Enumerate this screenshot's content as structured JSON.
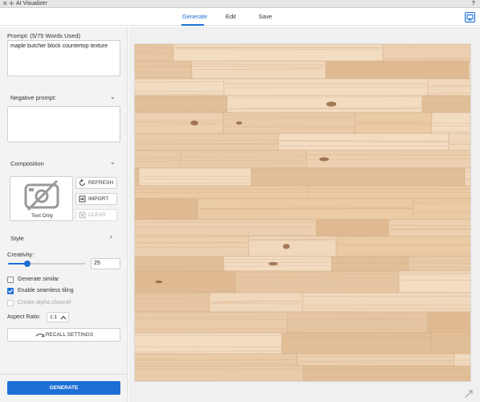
{
  "window": {
    "title": "AI Visualizer",
    "help": "?"
  },
  "tabs": [
    {
      "label": "Generate",
      "active": true
    },
    {
      "label": "Edit",
      "active": false
    },
    {
      "label": "Save",
      "active": false
    }
  ],
  "prompt": {
    "label": "Prompt: (5/75 Words Used)",
    "value": "maple butcher block countertop texture"
  },
  "negative_prompt": {
    "label": "Negative prompt:",
    "value": ""
  },
  "composition": {
    "label": "Composition",
    "thumbnail_caption": "Text Only",
    "buttons": {
      "refresh": "REFRESH",
      "import": "IMPORT",
      "clear": "CLEAR"
    }
  },
  "style": {
    "label": "Style"
  },
  "creativity": {
    "label": "Creativity:",
    "value": "25",
    "fraction": 0.25
  },
  "options": {
    "generate_similar": {
      "label": "Generate similar",
      "checked": false
    },
    "seamless_tiling": {
      "label": "Enable seamless tiling",
      "checked": true
    },
    "alpha_channel": {
      "label": "Create alpha channel",
      "checked": false,
      "disabled": true
    }
  },
  "aspect_ratio": {
    "label": "Aspect Ratio:",
    "value": "1:1"
  },
  "recall_settings": "RECALL SETTINGS",
  "generate_button": "GENERATE",
  "colors": {
    "accent": "#1d6fd6",
    "wood_base": "#e8c8a6"
  }
}
